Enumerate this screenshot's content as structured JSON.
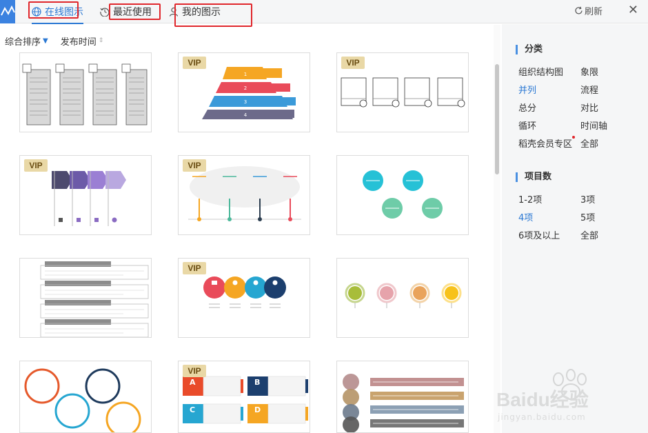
{
  "header": {
    "tabs": [
      {
        "label": "在线图示",
        "active": true
      },
      {
        "label": "最近使用",
        "active": false
      },
      {
        "label": "我的图示",
        "active": false
      }
    ],
    "refresh_label": "刷新",
    "close_glyph": "✕"
  },
  "sortbar": {
    "items": [
      {
        "label": "综合排序",
        "arrow": "🡇"
      },
      {
        "label": "发布时间",
        "arrow": "⇕"
      }
    ]
  },
  "cards": [
    {
      "id": 1,
      "vip": false
    },
    {
      "id": 2,
      "vip": true,
      "vip_label": "VIP"
    },
    {
      "id": 3,
      "vip": true,
      "vip_label": "VIP"
    },
    {
      "id": 4,
      "vip": true,
      "vip_label": "VIP"
    },
    {
      "id": 5,
      "vip": true,
      "vip_label": "VIP"
    },
    {
      "id": 6,
      "vip": false
    },
    {
      "id": 7,
      "vip": false
    },
    {
      "id": 8,
      "vip": true,
      "vip_label": "VIP"
    },
    {
      "id": 9,
      "vip": false
    },
    {
      "id": 10,
      "vip": false
    },
    {
      "id": 11,
      "vip": true,
      "vip_label": "VIP"
    },
    {
      "id": 12,
      "vip": false
    }
  ],
  "sidebar": {
    "category_title": "分类",
    "categories": [
      "组织结构图",
      "象限",
      "并列",
      "流程",
      "总分",
      "对比",
      "循环",
      "时间轴",
      "稻壳会员专区",
      "全部"
    ],
    "selected_category": "并列",
    "count_title": "项目数",
    "counts": [
      "1-2项",
      "3项",
      "4项",
      "5项",
      "6项及以上",
      "全部"
    ],
    "selected_count": "4项"
  },
  "colors": {
    "accent": "#2a78d3",
    "vip_bg": "#e9d8a6",
    "highlight_box": "#e0262b"
  },
  "watermark": {
    "text": "Baidu经验",
    "url_text": "jingyan.baidu.com"
  }
}
